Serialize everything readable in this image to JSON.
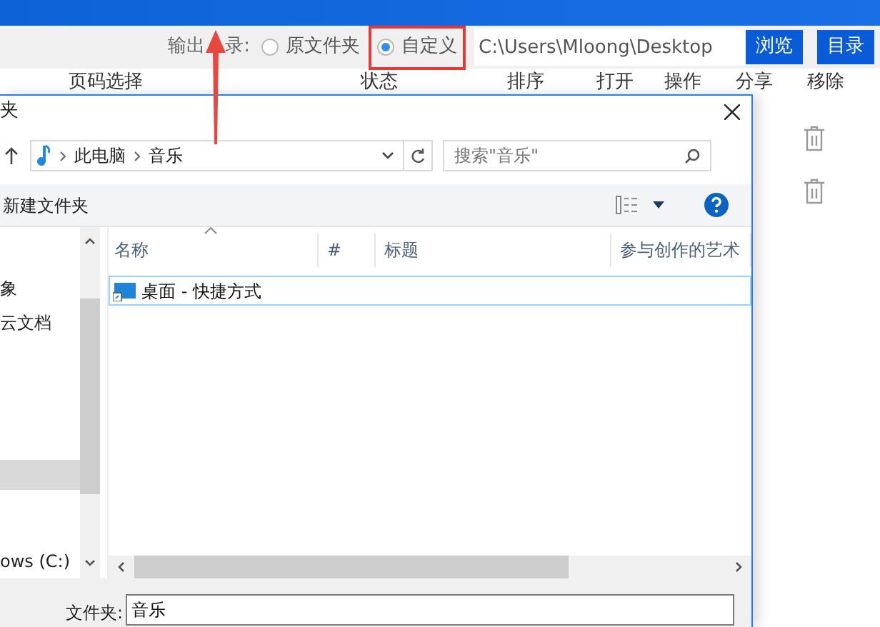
{
  "toolbar": {
    "output_label": [
      "输出",
      "录:"
    ],
    "options": [
      {
        "label": "原文件夹",
        "selected": false,
        "highlighted": false
      },
      {
        "label": "自定义",
        "selected": true,
        "highlighted": true
      }
    ],
    "path": "C:\\Users\\Mloong\\Desktop",
    "buttons": [
      "浏览",
      "目录"
    ]
  },
  "columns": [
    "页码选择",
    "状态",
    "排序",
    "打开",
    "操作",
    "分享",
    "移除"
  ],
  "dialog": {
    "title": "夹",
    "breadcrumb": [
      "此电脑",
      "音乐"
    ],
    "search": {
      "placeholder": "搜索\"音乐\""
    },
    "new_folder": "新建文件夹",
    "nav_items": [
      {
        "label": "象"
      },
      {
        "label": "云文档"
      },
      {
        "label": "ows (C:)"
      }
    ],
    "columns": [
      "名称",
      "#",
      "标题",
      "参与创作的艺术"
    ],
    "files": [
      {
        "name": "桌面 - 快捷方式",
        "selected": true
      }
    ],
    "folder_label": "文件夹:",
    "folder_value": "音乐"
  }
}
